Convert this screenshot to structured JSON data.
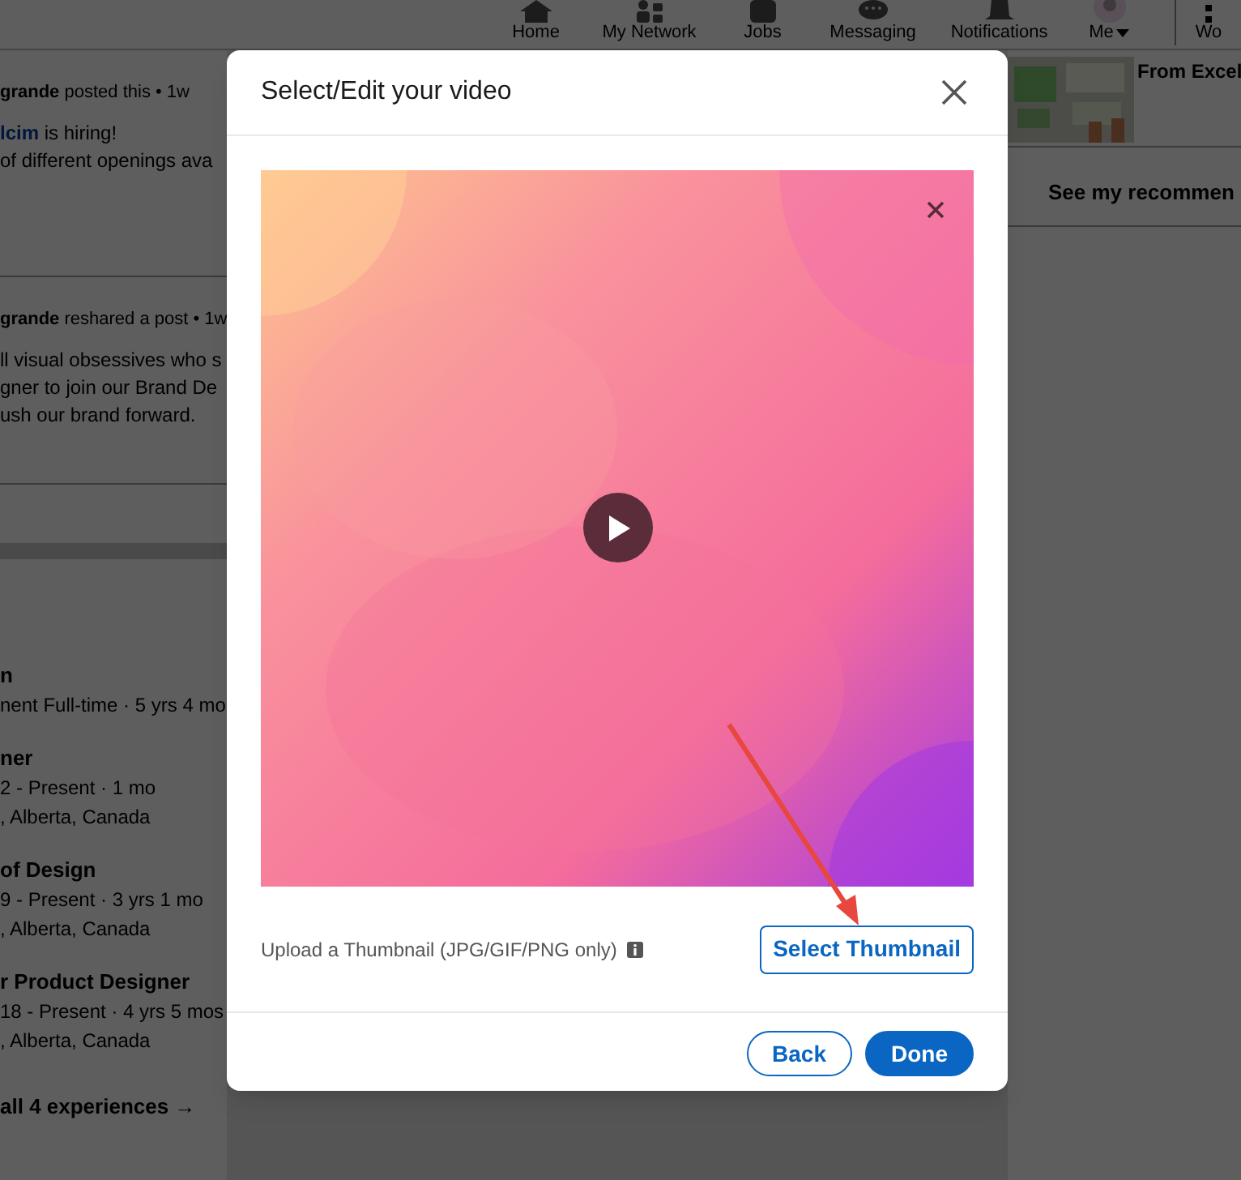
{
  "nav": {
    "items": [
      {
        "label": "Home"
      },
      {
        "label": "My Network"
      },
      {
        "label": "Jobs"
      },
      {
        "label": "Messaging"
      },
      {
        "label": "Notifications"
      },
      {
        "label": "Me",
        "caret": true
      },
      {
        "label": "Wo"
      }
    ]
  },
  "feed": {
    "posts": [
      {
        "meta_name": "grande",
        "meta": "posted this • 1w",
        "lines": [
          {
            "link": "lcim",
            "text": "is hiring!"
          },
          {
            "text": "of different openings ava"
          }
        ]
      },
      {
        "meta_name": "grande",
        "meta": "reshared a post • 1w",
        "lines": [
          {
            "text": "ll visual obsessives who s"
          },
          {
            "text": "gner to join our Brand De"
          },
          {
            "text": "ush our brand forward."
          }
        ]
      }
    ]
  },
  "experience": {
    "entries": [
      {
        "title": "n",
        "lines": [
          "nent Full-time · 5 yrs 4 mo"
        ]
      },
      {
        "title": "ner",
        "lines": [
          "2 - Present · 1 mo",
          ", Alberta, Canada"
        ]
      },
      {
        "title": "of Design",
        "lines": [
          "9 - Present · 3 yrs 1 mo",
          ", Alberta, Canada"
        ]
      },
      {
        "title": "r Product Designer",
        "lines": [
          "18 - Present · 4 yrs 5 mos",
          ", Alberta, Canada"
        ]
      }
    ],
    "show_all": "all 4 experiences →"
  },
  "sidebar": {
    "video_title": "From Excel",
    "recommendations": "See my recommen"
  },
  "modal": {
    "title": "Select/Edit your video",
    "upload_label": "Upload a Thumbnail (JPG/GIF/PNG only)",
    "select_button": "Select Thumbnail",
    "buttons": [
      {
        "label": "Back",
        "primary": false
      },
      {
        "label": "Done",
        "primary": true
      }
    ]
  }
}
